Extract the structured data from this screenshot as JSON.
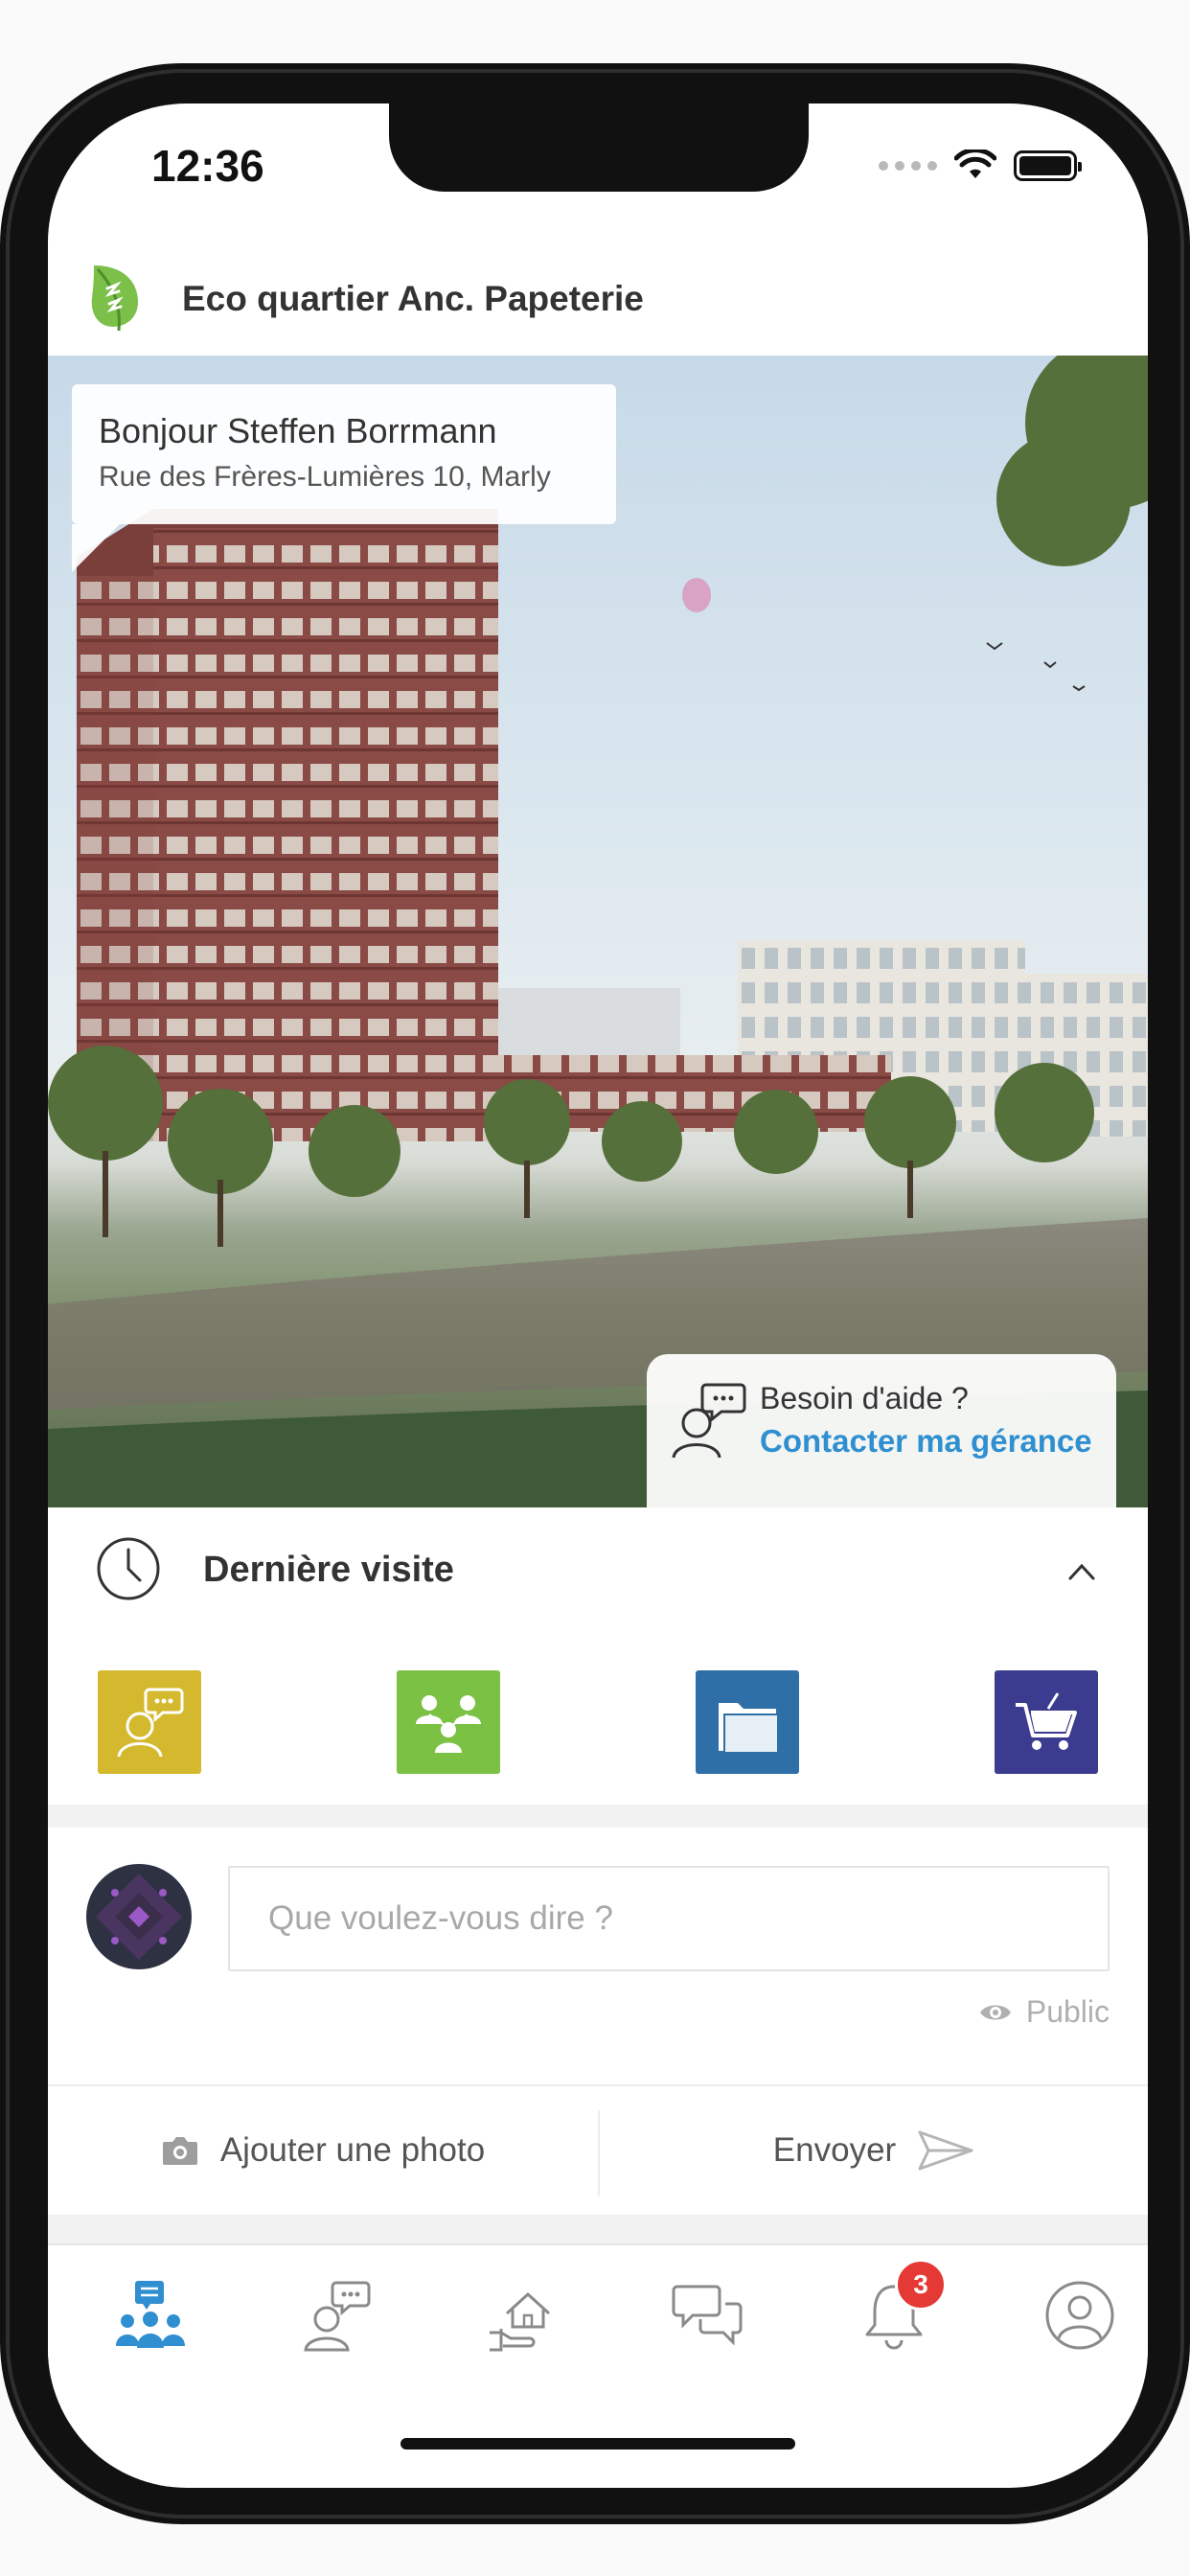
{
  "status_bar": {
    "time": "12:36"
  },
  "header": {
    "title": "Eco quartier Anc. Papeterie",
    "logo_icon": "leaf-logo-icon"
  },
  "hero": {
    "greeting": "Bonjour Steffen Borrmann",
    "address": "Rue des Frères-Lumières 10, Marly",
    "help_question": "Besoin d'aide ?",
    "help_link": "Contacter ma gérance"
  },
  "recent": {
    "title": "Dernière visite",
    "tiles": [
      {
        "icon": "support-chat-icon",
        "color": "#d4b92e"
      },
      {
        "icon": "community-icon",
        "color": "#7bc143"
      },
      {
        "icon": "documents-folder-icon",
        "color": "#2f6fa8"
      },
      {
        "icon": "shopping-cart-icon",
        "color": "#3b3b8f"
      }
    ]
  },
  "composer": {
    "placeholder": "Que voulez-vous dire ?",
    "visibility": "Public",
    "add_photo": "Ajouter une photo",
    "send": "Envoyer"
  },
  "tabbar": {
    "items": [
      {
        "icon": "community-feed-icon",
        "active": true
      },
      {
        "icon": "support-icon",
        "active": false
      },
      {
        "icon": "home-hand-icon",
        "active": false
      },
      {
        "icon": "messages-icon",
        "active": false
      },
      {
        "icon": "bell-icon",
        "active": false
      },
      {
        "icon": "profile-icon",
        "active": false
      }
    ],
    "notifications_badge": "3"
  },
  "colors": {
    "accent_blue": "#2f8fd0",
    "badge_red": "#e53935"
  }
}
